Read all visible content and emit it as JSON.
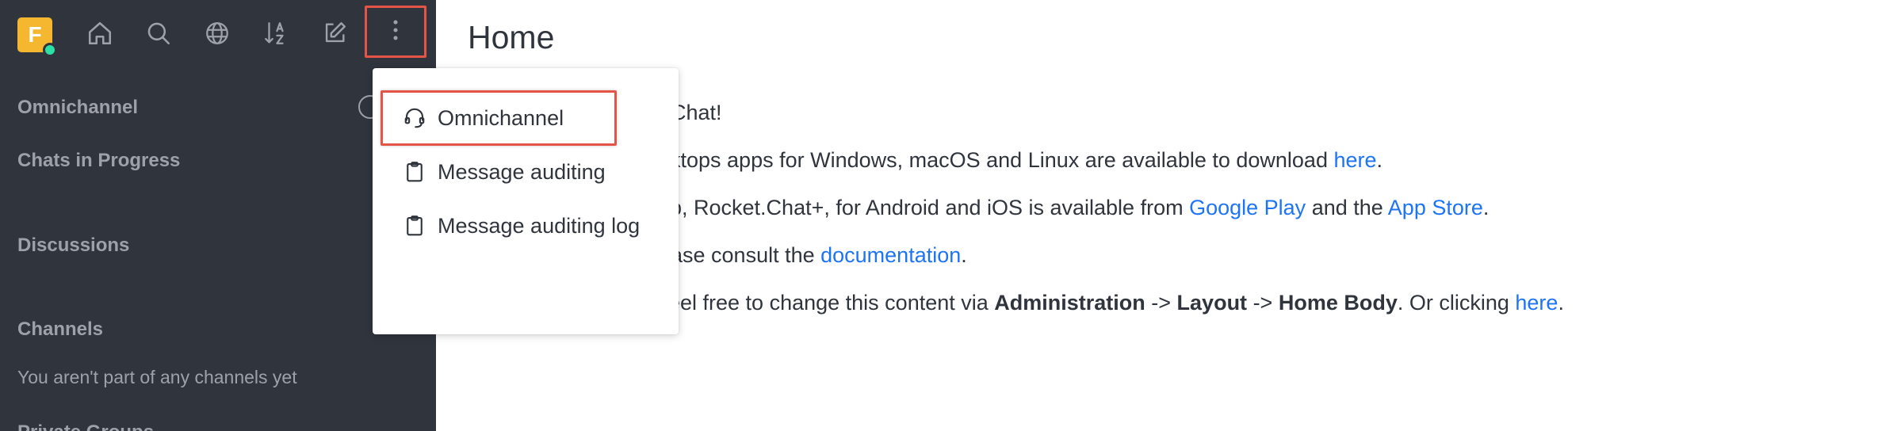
{
  "colors": {
    "sidebar_bg": "#2f343d",
    "sidebar_text": "#9ea2a8",
    "avatar_bg": "#f5b730",
    "status_online": "#2de0a5",
    "link": "#1d74f5",
    "highlight": "#e45547"
  },
  "topbar": {
    "avatar_letter": "F",
    "icons": [
      "home-icon",
      "search-icon",
      "directory-icon",
      "sort-icon",
      "create-new-icon",
      "kebab-menu-icon"
    ]
  },
  "sidebar": {
    "omnichannel_label": "Omnichannel",
    "chats_in_progress_label": "Chats in Progress",
    "discussions_label": "Discussions",
    "channels_label": "Channels",
    "channels_empty": "You aren't part of any channels yet",
    "private_groups_label": "Private Groups"
  },
  "main": {
    "title": "Home",
    "line1": "Chat!",
    "line2_text": "ktops apps for Windows, macOS and Linux are available to download ",
    "line2_link": "here",
    "line2_end": ".",
    "line3_text": "p, Rocket.Chat+, for Android and iOS is available from ",
    "line3_link1": "Google Play",
    "line3_mid": " and the ",
    "line3_link2": "App Store",
    "line3_end": ".",
    "line4_text": "ase consult the ",
    "line4_link": "documentation",
    "line4_end": ".",
    "line5_text": "eel free to change this content via ",
    "line5_b1": "Administration",
    "line5_arrow1": " -> ",
    "line5_b2": "Layout",
    "line5_arrow2": " -> ",
    "line5_b3": "Home Body",
    "line5_mid": ". Or clicking ",
    "line5_link": "here",
    "line5_end": "."
  },
  "menu": {
    "items": [
      {
        "label": "Omnichannel",
        "icon": "headset-icon"
      },
      {
        "label": "Message auditing",
        "icon": "clipboard-icon"
      },
      {
        "label": "Message auditing log",
        "icon": "clipboard-icon"
      }
    ]
  }
}
